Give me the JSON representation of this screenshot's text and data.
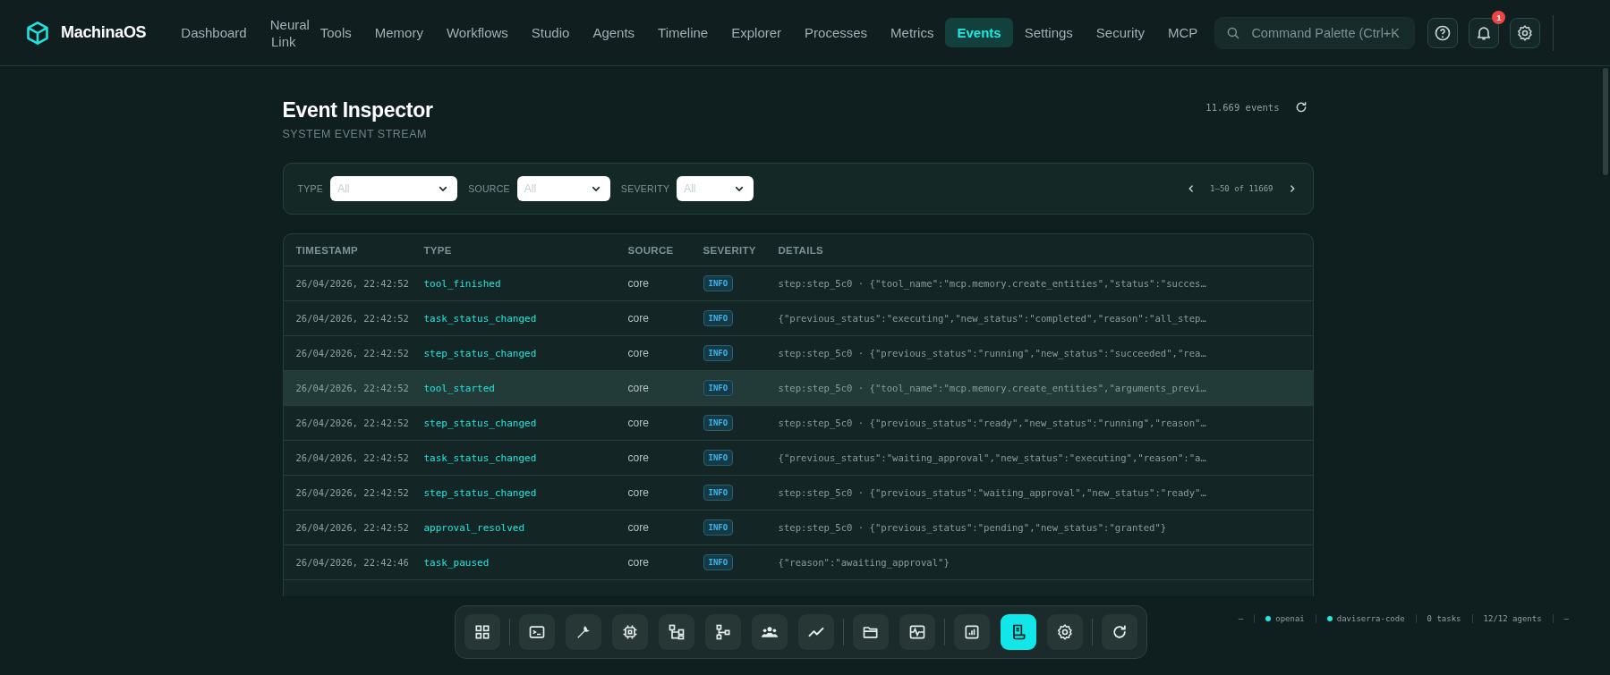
{
  "brand": {
    "name": "MachinaOS"
  },
  "nav": [
    {
      "label": "Dashboard",
      "selected": false
    },
    {
      "label": "Neural Link",
      "selected": false
    },
    {
      "label": "Tools",
      "selected": false
    },
    {
      "label": "Memory",
      "selected": false
    },
    {
      "label": "Workflows",
      "selected": false
    },
    {
      "label": "Studio",
      "selected": false
    },
    {
      "label": "Agents",
      "selected": false
    },
    {
      "label": "Timeline",
      "selected": false
    },
    {
      "label": "Explorer",
      "selected": false
    },
    {
      "label": "Processes",
      "selected": false
    },
    {
      "label": "Metrics",
      "selected": false
    },
    {
      "label": "Events",
      "selected": true
    },
    {
      "label": "Settings",
      "selected": false
    },
    {
      "label": "Security",
      "selected": false
    },
    {
      "label": "MCP",
      "selected": false
    }
  ],
  "search": {
    "placeholder": "Command Palette (Ctrl+K"
  },
  "notifications": {
    "count": "1"
  },
  "page": {
    "title": "Event Inspector",
    "subtitle": "SYSTEM EVENT STREAM",
    "count": "11.669 events"
  },
  "filters": [
    {
      "label": "TYPE",
      "value": "All"
    },
    {
      "label": "SOURCE",
      "value": "All"
    },
    {
      "label": "SEVERITY",
      "value": "All"
    }
  ],
  "pagination": {
    "range": "1–50 of 11669"
  },
  "table": {
    "columns": [
      "TIMESTAMP",
      "TYPE",
      "SOURCE",
      "SEVERITY",
      "DETAILS"
    ],
    "rows": [
      {
        "timestamp": "26/04/2026, 22:42:52",
        "type": "tool_finished",
        "source": "core",
        "severity": "INFO",
        "details": "step:step_5c0 · {\"tool_name\":\"mcp.memory.create_entities\",\"status\":\"succes…",
        "highlighted": false
      },
      {
        "timestamp": "26/04/2026, 22:42:52",
        "type": "task_status_changed",
        "source": "core",
        "severity": "INFO",
        "details": "{\"previous_status\":\"executing\",\"new_status\":\"completed\",\"reason\":\"all_step…",
        "highlighted": false
      },
      {
        "timestamp": "26/04/2026, 22:42:52",
        "type": "step_status_changed",
        "source": "core",
        "severity": "INFO",
        "details": "step:step_5c0 · {\"previous_status\":\"running\",\"new_status\":\"succeeded\",\"rea…",
        "highlighted": false
      },
      {
        "timestamp": "26/04/2026, 22:42:52",
        "type": "tool_started",
        "source": "core",
        "severity": "INFO",
        "details": "step:step_5c0 · {\"tool_name\":\"mcp.memory.create_entities\",\"arguments_previ…",
        "highlighted": true
      },
      {
        "timestamp": "26/04/2026, 22:42:52",
        "type": "step_status_changed",
        "source": "core",
        "severity": "INFO",
        "details": "step:step_5c0 · {\"previous_status\":\"ready\",\"new_status\":\"running\",\"reason\"…",
        "highlighted": false
      },
      {
        "timestamp": "26/04/2026, 22:42:52",
        "type": "task_status_changed",
        "source": "core",
        "severity": "INFO",
        "details": "{\"previous_status\":\"waiting_approval\",\"new_status\":\"executing\",\"reason\":\"a…",
        "highlighted": false
      },
      {
        "timestamp": "26/04/2026, 22:42:52",
        "type": "step_status_changed",
        "source": "core",
        "severity": "INFO",
        "details": "step:step_5c0 · {\"previous_status\":\"waiting_approval\",\"new_status\":\"ready\"…",
        "highlighted": false
      },
      {
        "timestamp": "26/04/2026, 22:42:52",
        "type": "approval_resolved",
        "source": "core",
        "severity": "INFO",
        "details": "step:step_5c0 · {\"previous_status\":\"pending\",\"new_status\":\"granted\"}",
        "highlighted": false
      },
      {
        "timestamp": "26/04/2026, 22:42:46",
        "type": "task_paused",
        "source": "core",
        "severity": "INFO",
        "details": "{\"reason\":\"awaiting_approval\"}",
        "highlighted": false
      }
    ]
  },
  "dock": [
    [
      {
        "selected": false
      }
    ],
    [
      {
        "selected": false
      },
      {
        "selected": false
      },
      {
        "selected": false
      },
      {
        "selected": false
      },
      {
        "selected": false
      },
      {
        "selected": false
      },
      {
        "selected": false
      }
    ],
    [
      {
        "selected": false
      },
      {
        "selected": false
      }
    ],
    [
      {
        "selected": false
      },
      {
        "selected": true
      },
      {
        "selected": false
      }
    ],
    [
      {
        "selected": false
      }
    ]
  ],
  "status_bar": [
    {
      "kind": "text",
      "text": "—"
    },
    {
      "kind": "dot",
      "text": "openai"
    },
    {
      "kind": "dot",
      "text": "daviserra-code"
    },
    {
      "kind": "text",
      "text": "0 tasks"
    },
    {
      "kind": "text",
      "text": "12/12 agents"
    },
    {
      "kind": "text",
      "text": "—"
    }
  ]
}
